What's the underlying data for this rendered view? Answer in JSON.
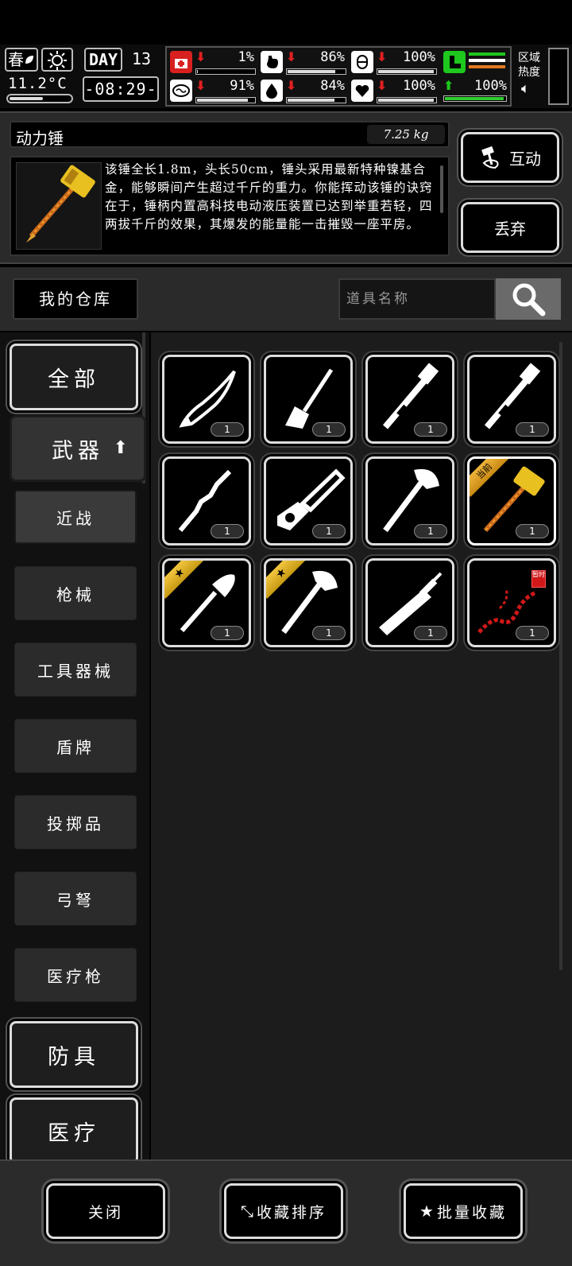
{
  "hud": {
    "season": "春",
    "temperature": "11.2°C",
    "temperature_level": 0.55,
    "day_label": "DAY",
    "day_number": "13",
    "clock": "-08:29-",
    "area_heat_label_1": "区域",
    "area_heat_label_2": "热度",
    "stats": [
      {
        "icon": "medkit-icon",
        "pct": "1%",
        "trend": "down",
        "level": 0.01
      },
      {
        "icon": "stomach-icon",
        "pct": "86%",
        "trend": "down",
        "level": 0.86
      },
      {
        "icon": "bladder-icon",
        "pct": "100%",
        "trend": "down",
        "level": 1.0
      },
      {
        "icon": "brain-icon",
        "pct": "91%",
        "trend": "down",
        "level": 0.91
      },
      {
        "icon": "water-drop-icon",
        "pct": "84%",
        "trend": "down",
        "level": 0.84
      },
      {
        "icon": "heart-icon",
        "pct": "100%",
        "trend": "down",
        "level": 1.0
      },
      {
        "icon": "stamina-boot-icon",
        "pct": "100%",
        "trend": "up",
        "level": 1.0
      }
    ]
  },
  "item": {
    "name": "动力锤",
    "weight": "7.25 kg",
    "description": "该锤全长1.8m，头长50cm，锤头采用最新特种镍基合金，能够瞬间产生超过千斤的重力。你能挥动该锤的诀窍在于，锤柄内置高科技电动液压装置已达到举重若轻，四两拔千斤的效果，其爆发的能量能一击摧毁一座平房。",
    "interact_label": "互动",
    "drop_label": "丢弃"
  },
  "warehouse": {
    "label": "我的仓库",
    "search_placeholder": "道具名称"
  },
  "categories": {
    "all": "全部",
    "weapons": "武器",
    "subs": [
      "近战",
      "枪械",
      "工具器械",
      "盾牌",
      "投掷品",
      "弓弩",
      "医疗枪"
    ],
    "armor": "防具",
    "medical": "医疗"
  },
  "items": [
    {
      "icon": "knife-icon",
      "qty": "1"
    },
    {
      "icon": "shovel-icon",
      "qty": "1"
    },
    {
      "icon": "pipe-wrench-icon",
      "qty": "1"
    },
    {
      "icon": "pipe-wrench-icon",
      "qty": "1"
    },
    {
      "icon": "branch-club-icon",
      "qty": "1"
    },
    {
      "icon": "chainsaw-icon",
      "qty": "1"
    },
    {
      "icon": "axe-icon",
      "qty": "1"
    },
    {
      "icon": "power-hammer-icon",
      "qty": "1",
      "ribbon": "当前"
    },
    {
      "icon": "shovel-icon",
      "qty": "1",
      "ribbon": "★"
    },
    {
      "icon": "axe-icon",
      "qty": "1",
      "ribbon": "★"
    },
    {
      "icon": "sword-icon",
      "qty": "1"
    },
    {
      "icon": "chain-whip-icon",
      "qty": "1",
      "tag": "暂时"
    }
  ],
  "bottom": {
    "close": "关闭",
    "sort_favorites": "收藏排序",
    "batch_favorite": "批量收藏"
  },
  "colors": {
    "panel": "#2a2a2a",
    "grid_bg": "#1c1c1c",
    "ribbon": "#e0a52a",
    "down": "#e02020",
    "up": "#1ec81e"
  }
}
